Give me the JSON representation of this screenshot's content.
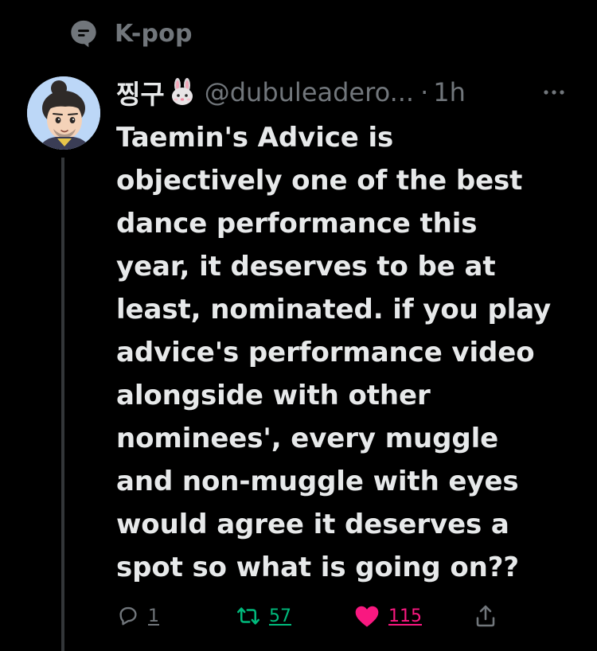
{
  "topic": {
    "label": "K-pop",
    "icon": "topic-chat-icon"
  },
  "tweet": {
    "author": {
      "display_name": "찡구",
      "name_emoji": "rabbit-face-icon",
      "handle": "@dubuleadero...",
      "separator": "·",
      "time": "1h"
    },
    "text": "Taemin's Advice is\nobjectively one of the best\ndance performance this\nyear, it deserves to be at\nleast, nominated. if you play\nadvice's performance video\nalongside with other\nnominees', every muggle\nand non-muggle with eyes\nwould agree it deserves a\nspot so what is going on??",
    "actions": {
      "reply_count": "1",
      "retweet_count": "57",
      "like_count": "115"
    }
  },
  "colors": {
    "background": "#000000",
    "text_primary": "#e7e9ea",
    "text_secondary": "#71767b",
    "retweet_active": "#00ba7c",
    "like_active": "#f91880",
    "thread_line": "#333639"
  }
}
